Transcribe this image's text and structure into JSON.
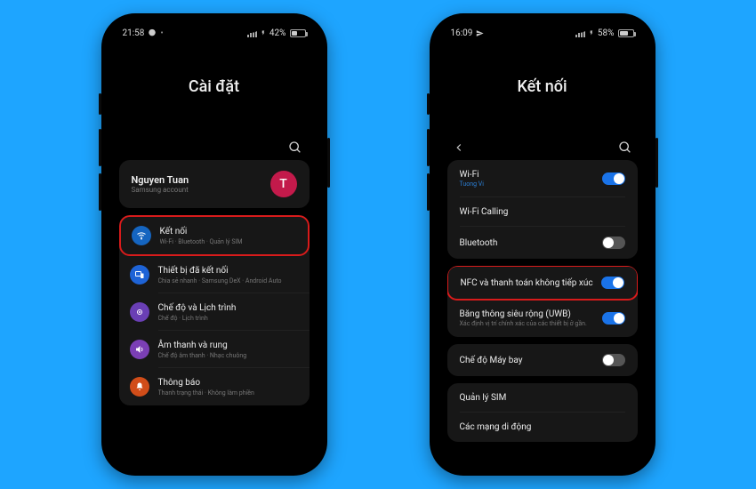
{
  "phone1": {
    "status": {
      "time": "21:58",
      "battery_pct": "42%",
      "battery_fill": 42
    },
    "title": "Cài đặt",
    "account": {
      "name": "Nguyen Tuan",
      "sub": "Samsung account",
      "initial": "T"
    },
    "items": [
      {
        "icon": "wifi",
        "bg": "#1565c0",
        "title": "Kết nối",
        "subtitle": "Wi-Fi · Bluetooth · Quản lý SIM",
        "highlight": true
      },
      {
        "icon": "devices",
        "bg": "#1e63d6",
        "title": "Thiết bị đã kết nối",
        "subtitle": "Chia sẻ nhanh · Samsung DeX · Android Auto",
        "highlight": false
      },
      {
        "icon": "modes",
        "bg": "#6a3fb5",
        "title": "Chế độ và Lịch trình",
        "subtitle": "Chế độ · Lịch trình",
        "highlight": false
      },
      {
        "icon": "sound",
        "bg": "#7b3fb5",
        "title": "Âm thanh và rung",
        "subtitle": "Chế độ âm thanh · Nhạc chuông",
        "highlight": false
      },
      {
        "icon": "notif",
        "bg": "#d14d19",
        "title": "Thông báo",
        "subtitle": "Thanh trạng thái · Không làm phiền",
        "highlight": false
      }
    ]
  },
  "phone2": {
    "status": {
      "time": "16:09",
      "battery_pct": "58%",
      "battery_fill": 58
    },
    "title": "Kết nối",
    "groups": [
      [
        {
          "label": "Wi-Fi",
          "sub": "Tuong Vi",
          "subStyle": "blue",
          "toggle": "on"
        },
        {
          "label": "Wi-Fi Calling",
          "toggle": null
        },
        {
          "label": "Bluetooth",
          "toggle": "off"
        }
      ],
      [
        {
          "label": "NFC và thanh toán không tiếp xúc",
          "toggle": "on",
          "highlight": true
        },
        {
          "label": "Băng thông siêu rộng (UWB)",
          "sub": "Xác định vị trí chính xác của các thiết bị ở gần.",
          "subStyle": "gray",
          "toggle": "on"
        }
      ],
      [
        {
          "label": "Chế độ Máy bay",
          "toggle": "off"
        }
      ],
      [
        {
          "label": "Quản lý SIM",
          "toggle": null
        },
        {
          "label": "Các mạng di động",
          "toggle": null
        }
      ]
    ]
  }
}
